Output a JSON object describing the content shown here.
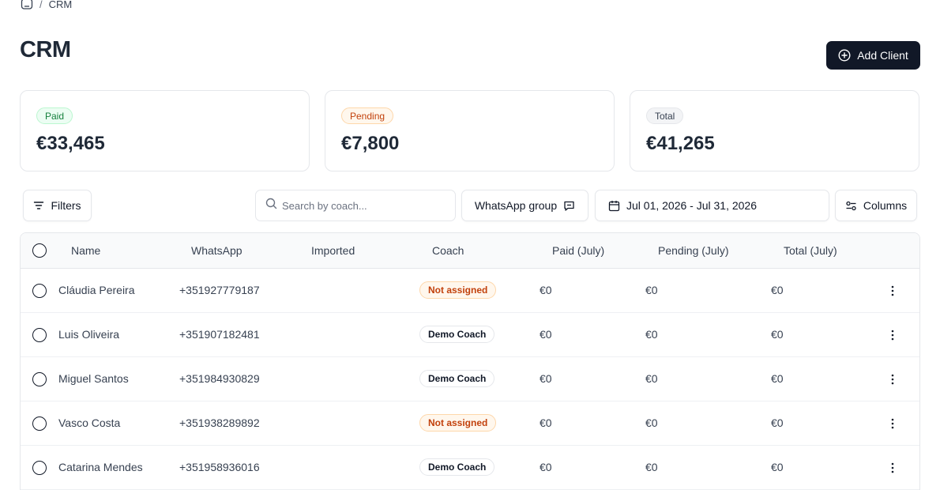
{
  "breadcrumb": {
    "separator": "/",
    "current": "CRM"
  },
  "page": {
    "title": "CRM",
    "add_button": "Add Client"
  },
  "stats": [
    {
      "label": "Paid",
      "value": "€33,465"
    },
    {
      "label": "Pending",
      "value": "€7,800"
    },
    {
      "label": "Total",
      "value": "€41,265"
    }
  ],
  "toolbar": {
    "filters": "Filters",
    "search_placeholder": "Search by coach...",
    "whatsapp_group": "WhatsApp group",
    "date_range": "Jul 01, 2026 - Jul 31, 2026",
    "columns": "Columns"
  },
  "table": {
    "headers": [
      "Name",
      "WhatsApp",
      "Imported",
      "Coach",
      "Paid (July)",
      "Pending (July)",
      "Total (July)"
    ],
    "rows": [
      {
        "name": "Cláudia Pereira",
        "whatsapp": "+351927779187",
        "imported": "",
        "coach": "Not assigned",
        "paid": "€0",
        "pending": "€0",
        "total": "€0"
      },
      {
        "name": "Luis Oliveira",
        "whatsapp": "+351907182481",
        "imported": "",
        "coach": "Demo Coach",
        "paid": "€0",
        "pending": "€0",
        "total": "€0"
      },
      {
        "name": "Miguel Santos",
        "whatsapp": "+351984930829",
        "imported": "",
        "coach": "Demo Coach",
        "paid": "€0",
        "pending": "€0",
        "total": "€0"
      },
      {
        "name": "Vasco Costa",
        "whatsapp": "+351938289892",
        "imported": "",
        "coach": "Not assigned",
        "paid": "€0",
        "pending": "€0",
        "total": "€0"
      },
      {
        "name": "Catarina Mendes",
        "whatsapp": "+351958936016",
        "imported": "",
        "coach": "Demo Coach",
        "paid": "€0",
        "pending": "€0",
        "total": "€0"
      }
    ]
  },
  "colors": {
    "primary_dark": "#111827",
    "pending_orange": "#c2410c",
    "paid_green": "#15803d"
  },
  "icons": {
    "home": "home-icon",
    "add": "plus-circle-icon",
    "filter": "filter-icon",
    "search": "search-icon",
    "chat": "message-square-icon",
    "calendar": "calendar-icon",
    "columns": "sliders-icon",
    "row_menu": "more-vertical-icon"
  }
}
